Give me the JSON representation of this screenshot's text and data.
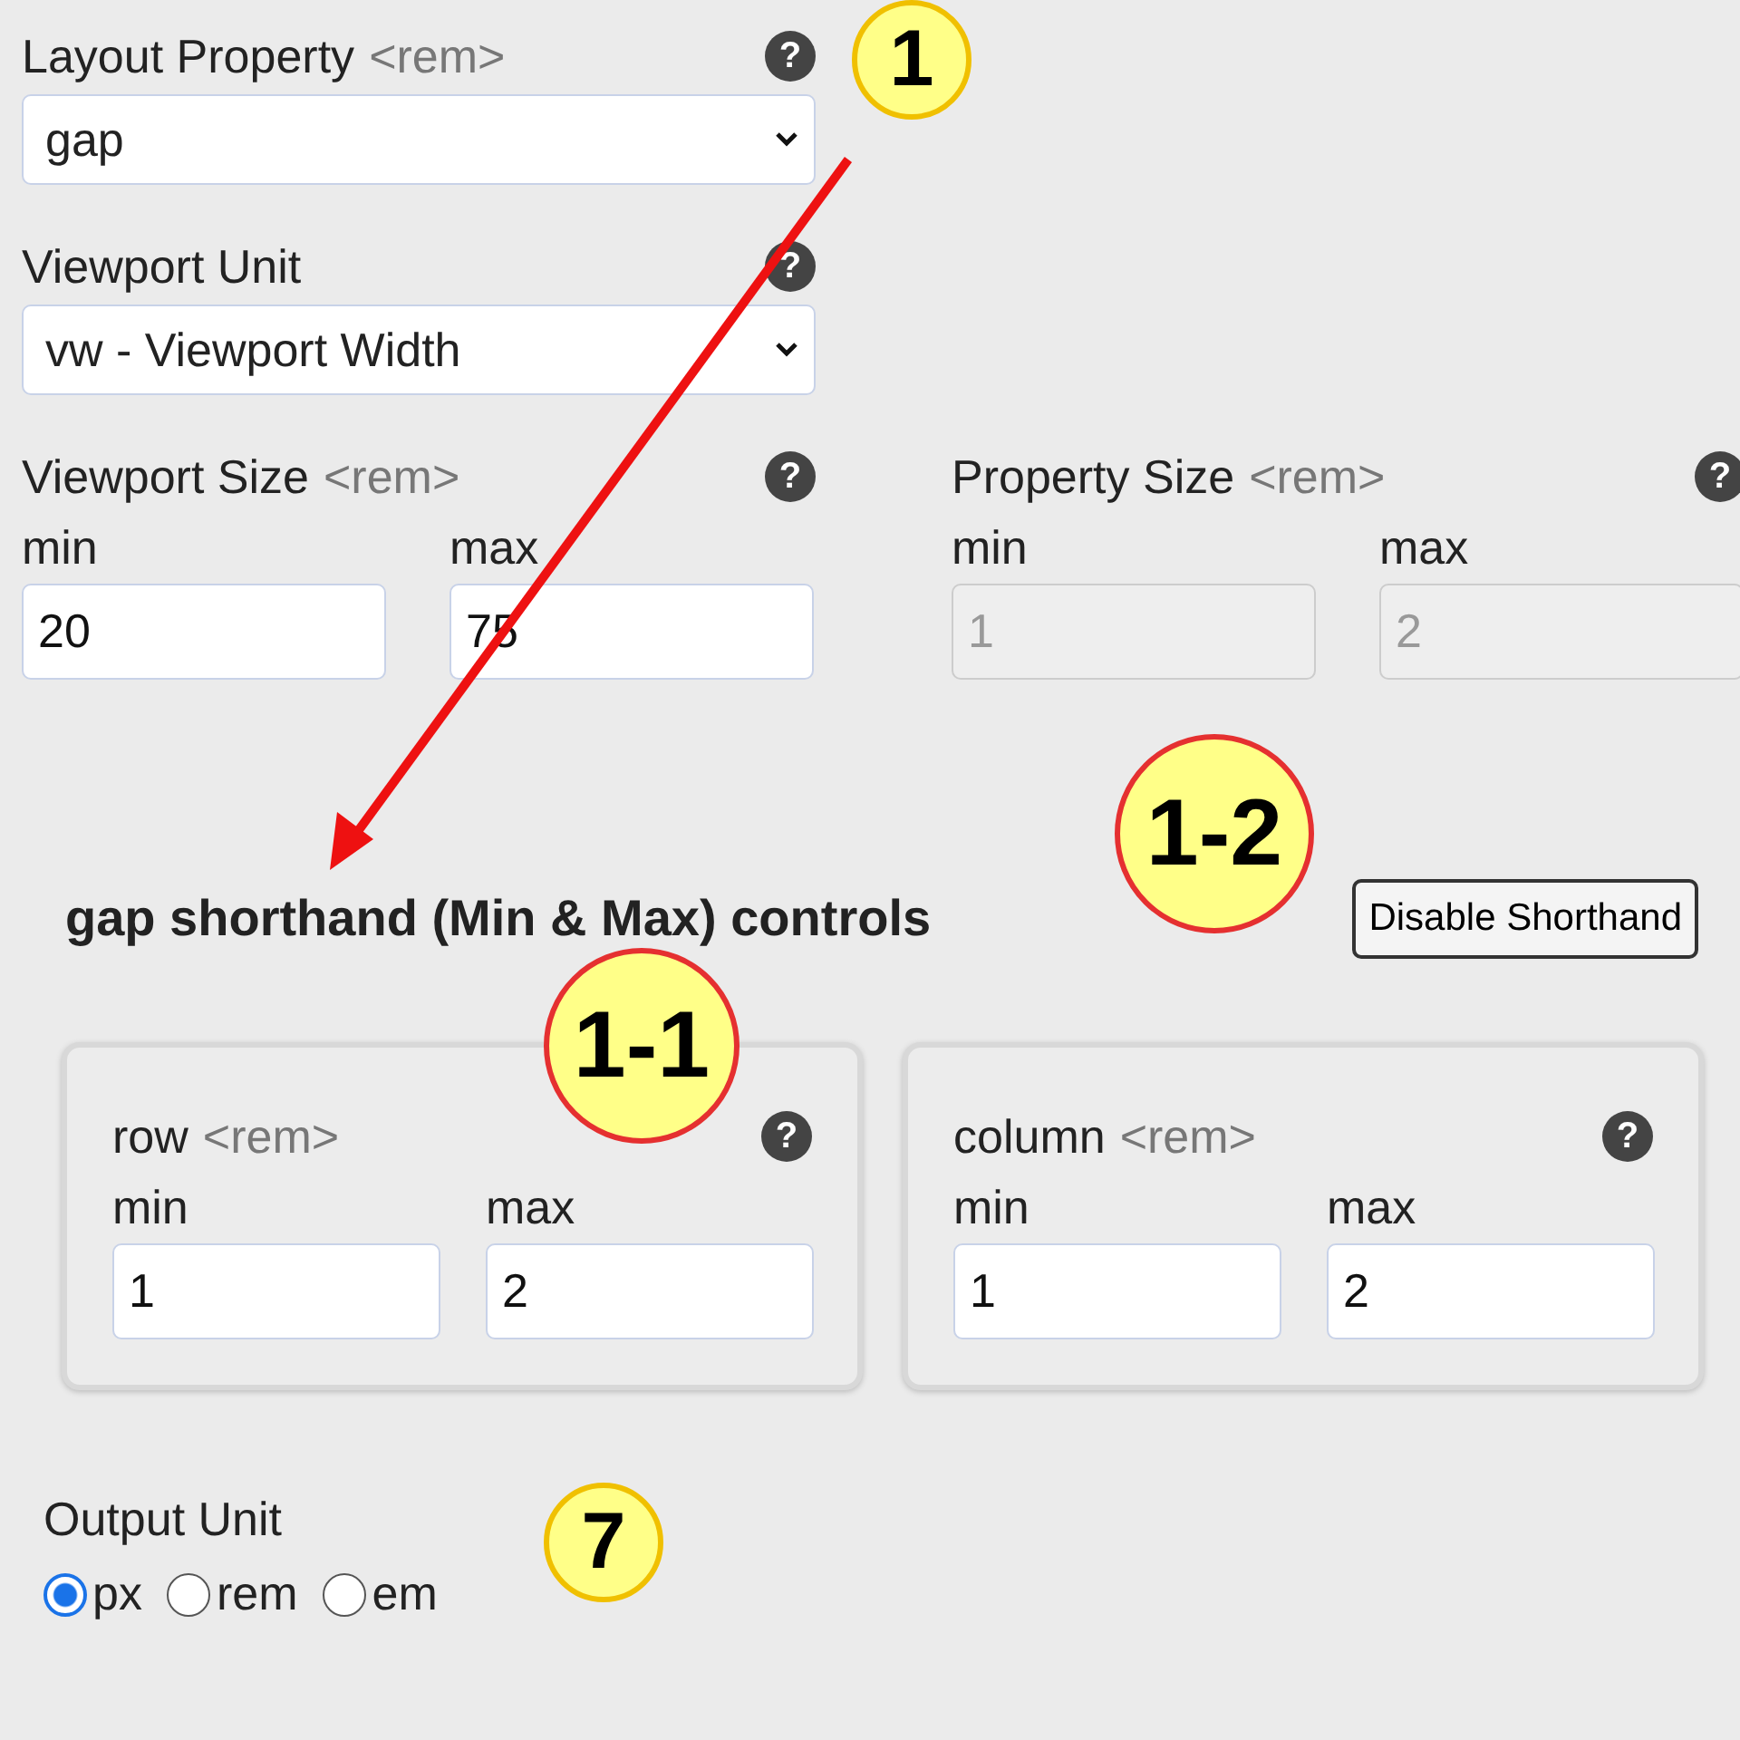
{
  "fields": [
    {
      "kind": "select",
      "label": "Layout Property",
      "unit": "<rem>",
      "help": "?",
      "value": "gap"
    },
    {
      "kind": "select",
      "label": "Viewport Unit",
      "help": "?",
      "value": "vw - Viewport Width"
    }
  ],
  "ranges": [
    {
      "label": "Viewport Size",
      "unit": "<rem>",
      "help": "?",
      "disabled": false,
      "min_label": "min",
      "max_label": "max",
      "min": "20",
      "max": "75"
    },
    {
      "label": "Property Size",
      "unit": "<rem>",
      "help": "?",
      "disabled": true,
      "min_label": "min",
      "max_label": "max",
      "min": "1",
      "max": "2"
    }
  ],
  "shorthand": {
    "title": "gap shorthand (Min & Max) controls",
    "button": "Disable Shorthand",
    "cards": [
      {
        "label": "row",
        "unit": "<rem>",
        "help": "?",
        "disabled": false,
        "min_label": "min",
        "max_label": "max",
        "min": "1",
        "max": "2"
      },
      {
        "label": "column",
        "unit": "<rem>",
        "help": "?",
        "disabled": false,
        "min_label": "min",
        "max_label": "max",
        "min": "1",
        "max": "2"
      }
    ]
  },
  "output": {
    "label": "Output Unit",
    "options": [
      {
        "label": "px",
        "selected": true
      },
      {
        "label": "rem",
        "selected": false
      },
      {
        "label": "em",
        "selected": false
      }
    ]
  },
  "annotations": [
    {
      "label": "1",
      "color": "#ffff88"
    },
    {
      "label": "1-2",
      "color": "#ffff88"
    },
    {
      "label": "1-1",
      "color": "#ffff88"
    },
    {
      "label": "7",
      "color": "#ffff88"
    }
  ]
}
